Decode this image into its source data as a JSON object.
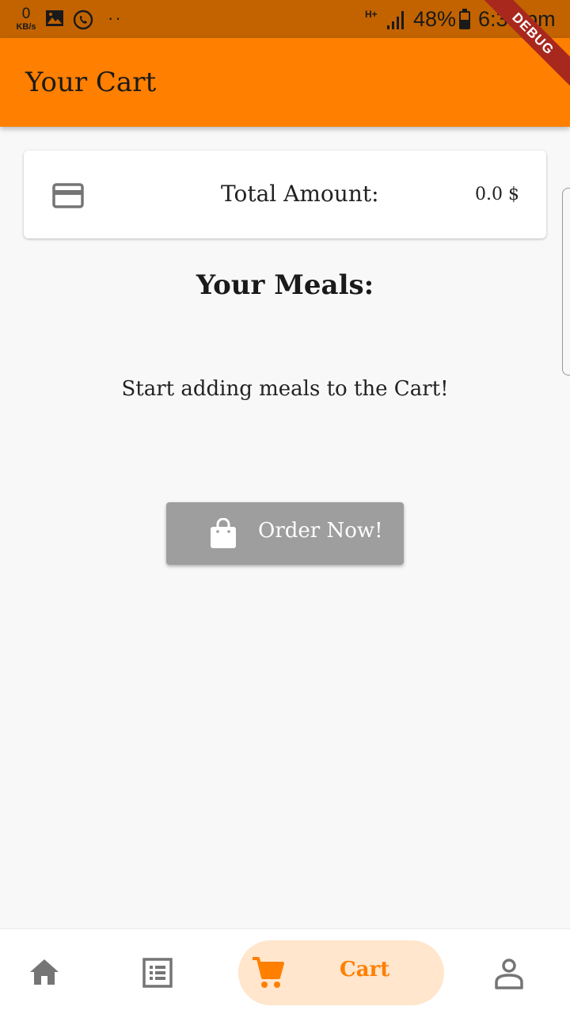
{
  "status_bar": {
    "speed_value": "0",
    "speed_unit": "KB/s",
    "dots": "··",
    "network": "H+",
    "battery_percent": "48%",
    "time": "6:30 pm"
  },
  "debug_banner": "DEBUG",
  "app_bar": {
    "title": "Your Cart"
  },
  "total_card": {
    "label": "Total Amount:",
    "amount": "0.0 $",
    "icon": "credit-card-icon"
  },
  "meals": {
    "heading": "Your Meals:",
    "empty_message": "Start adding meals to the Cart!"
  },
  "order_button": {
    "label": "Order Now!",
    "icon": "shopping-bag-icon"
  },
  "bottom_nav": {
    "items": [
      {
        "icon": "home-icon"
      },
      {
        "icon": "menu-list-icon"
      },
      {
        "icon": "cart-icon",
        "label": "Cart",
        "active": true
      },
      {
        "icon": "profile-icon"
      }
    ]
  },
  "colors": {
    "accent": "#ff7f00",
    "status_bar": "#c26300",
    "button_disabled": "#9e9e9e",
    "active_pill": "#ffe6cc"
  }
}
